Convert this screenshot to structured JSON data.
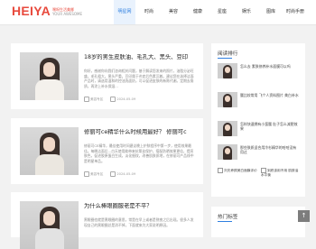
{
  "header": {
    "logo": "HEIYA",
    "logo_suffix": ".cn",
    "logo_tagline": "嘿呀生活美娜",
    "logo_tagline2": "YOUR AWESOME",
    "nav": [
      "明星网",
      "时尚",
      "美容",
      "健康",
      "星座",
      "娱乐",
      "图库",
      "时尚手册"
    ],
    "active_index": 0
  },
  "articles": [
    {
      "title": "18岁的男生皮肤油、毛孔大、黑头、豆印",
      "desc": "你好，感谢你向我们咨询相关问题，基于解读您发来的照片，油脂分泌旺盛，毛孔粗大，黑头严重，豆印属于炎症后色素沉着。建议您在选择洁面产品时，请选用温和的控油洗面奶，可以促进皮肤的新陈代谢。定期去角质，再涂上补水保湿...",
      "author": "美容专区",
      "date": "2024-05-09"
    },
    {
      "title": "修丽可ce精华什么时候用最好？ 修丽可c",
      "desc": "修丽可CE精华，最佳使用时间建议晚上护肤程序中第一步，使用效果最佳。每晚洁面后...白天使用能带来抗氧化保护，搭配防晒效果更佳，提亮肤色，促进胶原蛋白生成，淡化细纹，改善肌肤质地，在修丽可产品线中是明星单品。",
      "author": "美容专区",
      "date": "2024-05-09"
    },
    {
      "title": "为什么棒眼圈服老是不平？",
      "desc": "黑眼圈也就是黑眼圈的意思，常是在早上或者是熬夜之后出现。很多人发现自己的黑眼圈总是消不掉，下面就来为大家说明原因。",
      "author": "",
      "date": ""
    }
  ],
  "sidebar": {
    "title": "阅读排行",
    "items": [
      "怎么去 素肤修养补水面膜可以吗",
      "腰比较常用 飞个人资料图片 美白补水",
      "怎样快速拥有小蛮腰 肚子怎么减肥效果",
      "那些肤质适合用冷杉精华的哈哈没有用过"
    ],
    "pair": [
      "刘夫养颜美白面膜评价",
      "到底该用不用 肌肤油水平衡"
    ],
    "hot_title": "热门标签"
  },
  "scroll_top_label": "↑"
}
